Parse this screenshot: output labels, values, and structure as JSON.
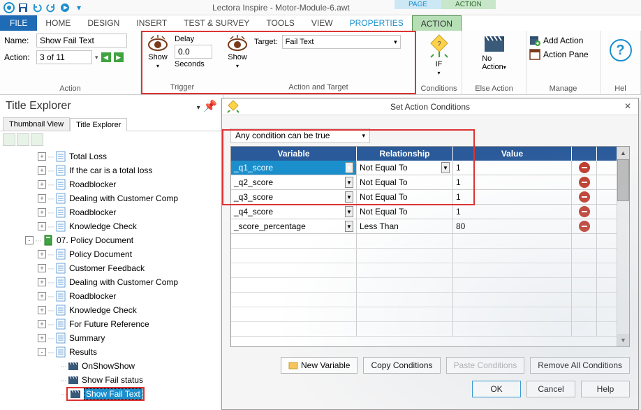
{
  "app": {
    "title": "Lectora Inspire - Motor-Module-6.awt"
  },
  "contextTabs": {
    "page": "PAGE",
    "action": "ACTION"
  },
  "tabs": [
    "FILE",
    "HOME",
    "DESIGN",
    "INSERT",
    "TEST & SURVEY",
    "TOOLS",
    "VIEW",
    "PROPERTIES",
    "ACTION"
  ],
  "ribbon": {
    "action": {
      "nameLabel": "Name:",
      "nameValue": "Show Fail Text",
      "actionLabel": "Action:",
      "actionValue": "3 of 11",
      "group": "Action"
    },
    "trigger": {
      "showLabel": "Show",
      "delayLabel": "Delay",
      "delayValue": "0.0",
      "secondsLabel": "Seconds",
      "group": "Trigger"
    },
    "actionTarget": {
      "showLabel": "Show",
      "targetLabel": "Target:",
      "targetValue": "Fail Text",
      "group": "Action and Target"
    },
    "conditions": {
      "ifLabel": "IF",
      "group": "Conditions"
    },
    "elseAction": {
      "noActionLabel1": "No",
      "noActionLabel2": "Action",
      "group": "Else Action"
    },
    "manage": {
      "addAction": "Add Action",
      "actionPane": "Action Pane",
      "group": "Manage"
    },
    "help": {
      "group": "Hel"
    }
  },
  "titleExplorer": {
    "title": "Title Explorer",
    "tabs": {
      "thumb": "Thumbnail View",
      "tree": "Title Explorer"
    },
    "items": [
      {
        "indent": 3,
        "tw": "+",
        "icon": "page",
        "label": "Total Loss"
      },
      {
        "indent": 3,
        "tw": "+",
        "icon": "page",
        "label": "If the car is a total loss"
      },
      {
        "indent": 3,
        "tw": "+",
        "icon": "page",
        "label": "Roadblocker"
      },
      {
        "indent": 3,
        "tw": "+",
        "icon": "page",
        "label": "Dealing with Customer Comp"
      },
      {
        "indent": 3,
        "tw": "+",
        "icon": "page",
        "label": "Roadblocker"
      },
      {
        "indent": 3,
        "tw": "+",
        "icon": "page",
        "label": "Knowledge Check"
      },
      {
        "indent": 2,
        "tw": "-",
        "icon": "chapter",
        "label": "07. Policy Document"
      },
      {
        "indent": 3,
        "tw": "+",
        "icon": "page",
        "label": "Policy Document"
      },
      {
        "indent": 3,
        "tw": "+",
        "icon": "page",
        "label": "Customer Feedback"
      },
      {
        "indent": 3,
        "tw": "+",
        "icon": "page",
        "label": "Dealing with Customer Comp"
      },
      {
        "indent": 3,
        "tw": "+",
        "icon": "page",
        "label": "Roadblocker"
      },
      {
        "indent": 3,
        "tw": "+",
        "icon": "page",
        "label": "Knowledge Check"
      },
      {
        "indent": 3,
        "tw": "+",
        "icon": "page",
        "label": "For Future Reference"
      },
      {
        "indent": 3,
        "tw": "+",
        "icon": "page",
        "label": "Summary"
      },
      {
        "indent": 3,
        "tw": "-",
        "icon": "page",
        "label": "Results"
      },
      {
        "indent": 4,
        "tw": " ",
        "icon": "action",
        "label": "OnShowShow"
      },
      {
        "indent": 4,
        "tw": " ",
        "icon": "action",
        "label": "Show Fail status"
      },
      {
        "indent": 4,
        "tw": " ",
        "icon": "action",
        "label": "Show Fail Text",
        "selected": true
      }
    ]
  },
  "dialog": {
    "title": "Set Action Conditions",
    "anyCondition": "Any condition can be true",
    "headers": {
      "variable": "Variable",
      "relationship": "Relationship",
      "value": "Value"
    },
    "rows": [
      {
        "variable": "_q1_score",
        "relationship": "Not Equal To",
        "value": "1",
        "sel": true
      },
      {
        "variable": "_q2_score",
        "relationship": "Not Equal To",
        "value": "1"
      },
      {
        "variable": "_q3_score",
        "relationship": "Not Equal To",
        "value": "1"
      },
      {
        "variable": "_q4_score",
        "relationship": "Not Equal To",
        "value": "1"
      },
      {
        "variable": "_score_percentage",
        "relationship": "Less Than",
        "value": "80"
      }
    ],
    "buttons": {
      "newVariable": "New Variable",
      "copyConditions": "Copy Conditions",
      "pasteConditions": "Paste Conditions",
      "removeAll": "Remove All Conditions",
      "ok": "OK",
      "cancel": "Cancel",
      "help": "Help"
    }
  }
}
